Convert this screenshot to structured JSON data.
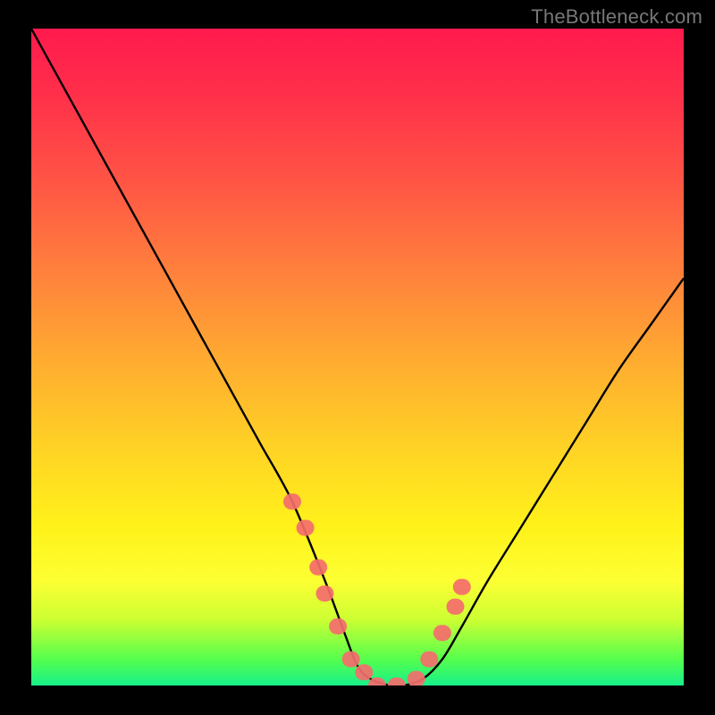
{
  "watermark": "TheBottleneck.com",
  "chart_data": {
    "type": "line",
    "title": "",
    "xlabel": "",
    "ylabel": "",
    "xlim": [
      0,
      100
    ],
    "ylim": [
      0,
      100
    ],
    "x": [
      0,
      5,
      10,
      15,
      20,
      25,
      30,
      35,
      40,
      45,
      48,
      50,
      52,
      55,
      57,
      60,
      63,
      66,
      70,
      75,
      80,
      85,
      90,
      95,
      100
    ],
    "values": [
      100,
      91,
      82,
      73,
      64,
      55,
      46,
      37,
      28,
      16,
      8,
      3,
      1,
      0,
      0,
      1,
      4,
      9,
      16,
      24,
      32,
      40,
      48,
      55,
      62
    ],
    "annotations": {
      "markers_x": [
        40,
        42,
        44,
        45,
        47,
        49,
        51,
        53,
        56,
        59,
        61,
        63,
        65,
        66
      ],
      "markers_y": [
        28,
        24,
        18,
        14,
        9,
        4,
        2,
        0,
        0,
        1,
        4,
        8,
        12,
        15
      ],
      "marker_color": "#f46d6d"
    },
    "gradient_stops": [
      {
        "pos": 0.0,
        "color": "#ff1a4d"
      },
      {
        "pos": 0.25,
        "color": "#ff5a44"
      },
      {
        "pos": 0.5,
        "color": "#ffb02f"
      },
      {
        "pos": 0.76,
        "color": "#fff21a"
      },
      {
        "pos": 0.96,
        "color": "#55ff4d"
      },
      {
        "pos": 1.0,
        "color": "#17f08a"
      }
    ]
  }
}
